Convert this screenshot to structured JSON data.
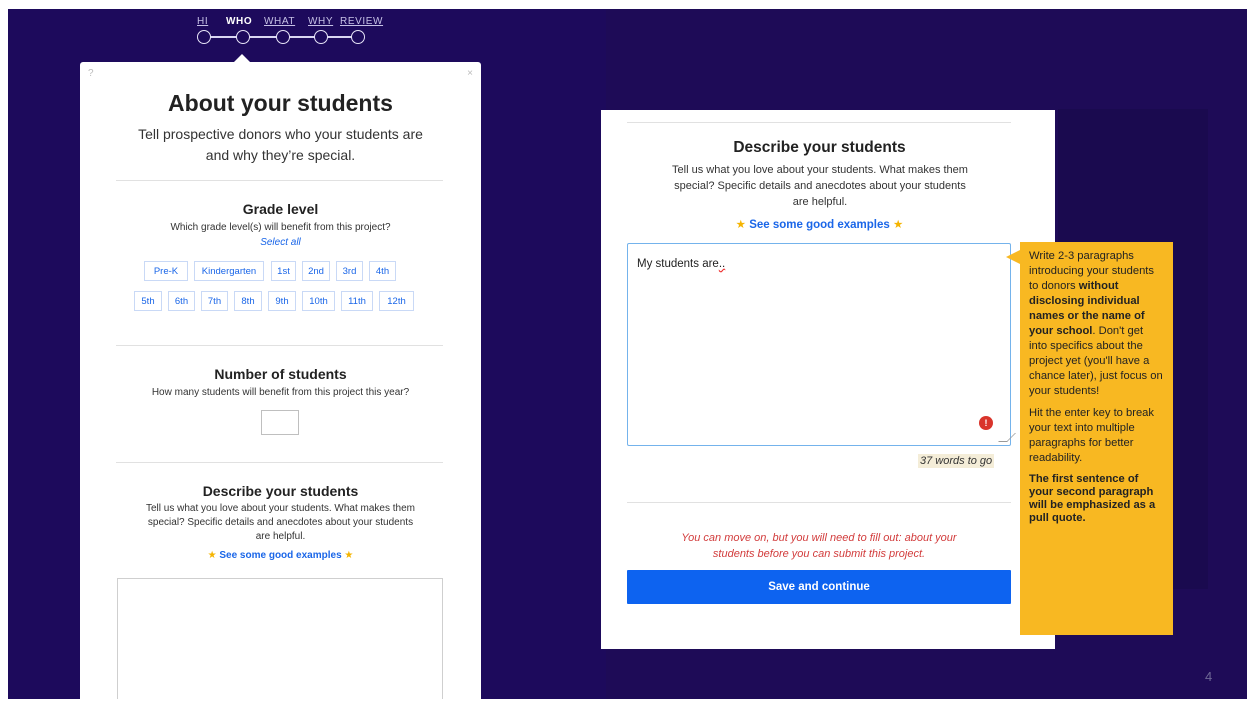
{
  "stepper": {
    "steps": [
      "HI",
      "WHO",
      "WHAT",
      "WHY",
      "REVIEW"
    ],
    "active": "WHO"
  },
  "left_modal": {
    "help_icon": "?",
    "close_icon": "×",
    "title": "About your students",
    "subtitle_line1": "Tell prospective donors who your students are",
    "subtitle_line2": "and why they’re special.",
    "grade": {
      "title": "Grade level",
      "help": "Which grade level(s) will benefit from this project?",
      "select_all": "Select all",
      "row1": [
        "Pre-K",
        "Kindergarten",
        "1st",
        "2nd",
        "3rd",
        "4th"
      ],
      "row2": [
        "5th",
        "6th",
        "7th",
        "8th",
        "9th",
        "10th",
        "11th",
        "12th"
      ]
    },
    "students": {
      "title": "Number of students",
      "help": "How many students will benefit from this project this year?",
      "value": ""
    },
    "describe": {
      "title": "Describe your students",
      "help_line1": "Tell us what you love about your students. What makes them",
      "help_line2": "special? Specific details and anecdotes about your students",
      "help_line3": "are helpful.",
      "examples": "See some good examples",
      "value": ""
    }
  },
  "right_modal": {
    "title": "Describe your students",
    "help_line1": "Tell us what you love about your students. What makes them",
    "help_line2": "special? Specific details and anecdotes about your students",
    "help_line3": "are helpful.",
    "examples": "See some good examples",
    "textarea_value_main": "My students are",
    "textarea_value_dots": "..",
    "error_badge": "!",
    "word_counter": "37 words to go",
    "warning_line1": "You can move on, but you will need to fill out: about your",
    "warning_line2": "students before you can submit this project.",
    "save_button": "Save and continue"
  },
  "tooltip": {
    "p1_a": "Write 2-3 paragraphs introducing your students to donors ",
    "p1_bold": "without disclosing individual names or the name of your school",
    "p1_b": ". Don't get into specifics about the project yet (you'll have a chance later), just focus on your students!",
    "p2": "Hit the enter key to break your text into multiple paragraphs for better readability.",
    "p3": "The first sentence of your second paragraph will be emphasized as a pull quote."
  },
  "page_number": "4",
  "colors": {
    "background": "#1d0a5c",
    "accent_blue": "#0d63f0",
    "link_blue": "#1a66e8",
    "tooltip": "#f8b822",
    "warning_red": "#d23c3c",
    "star": "#f5b400"
  }
}
